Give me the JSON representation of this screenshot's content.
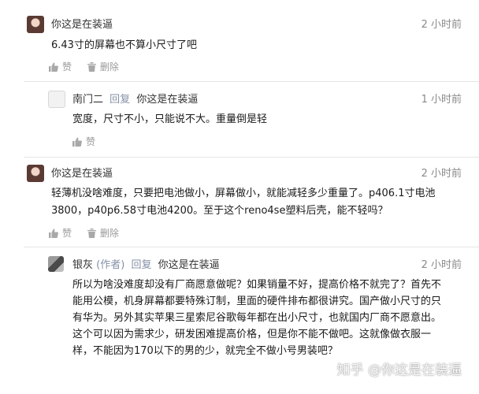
{
  "comments": [
    {
      "author": "你这是在装逼",
      "time": "2 小时前",
      "text": "6.43寸的屏幕也不算小尺寸了吧",
      "like_label": "赞",
      "delete_label": "删除"
    },
    {
      "author": "南门二",
      "reply_label": "回复",
      "reply_to": "你这是在装逼",
      "time": "1 小时前",
      "text": "宽度，尺寸不小，只能说不大。重量倒是轻",
      "like_label": "赞"
    },
    {
      "author": "你这是在装逼",
      "time": "2 小时前",
      "text_lines": [
        "轻薄机没啥难度，只要把电池做小，屏幕做小，就能减轻多少重量了。p406.1寸电池",
        "3800，p40p6.58寸电池4200。至于这个reno4se塑料后壳，能不轻吗？"
      ],
      "like_label": "赞",
      "delete_label": "删除"
    },
    {
      "author": "银灰",
      "author_tag": "(作者)",
      "reply_label": "回复",
      "reply_to": "你这是在装逼",
      "time": "2 小时前",
      "text_lines": [
        "所以为啥没难度却没有厂商愿意做呢？如果销量不好，提高价格不就完了？首先不",
        "能用公模，机身屏幕都要特殊订制，里面的硬件排布都很讲究。国产做小尺寸的只",
        "有华为。另外其实苹果三星索尼谷歌每年都在出小尺寸，也就国内厂商不愿意出。",
        "这个可以因为需求少，研发困难提高价格，但是你不能不做吧。这就像做衣服一",
        "样，不能因为170以下的男的少，就完全不做小号男装吧？"
      ]
    }
  ],
  "watermark": "知乎 @你这是在装逼"
}
